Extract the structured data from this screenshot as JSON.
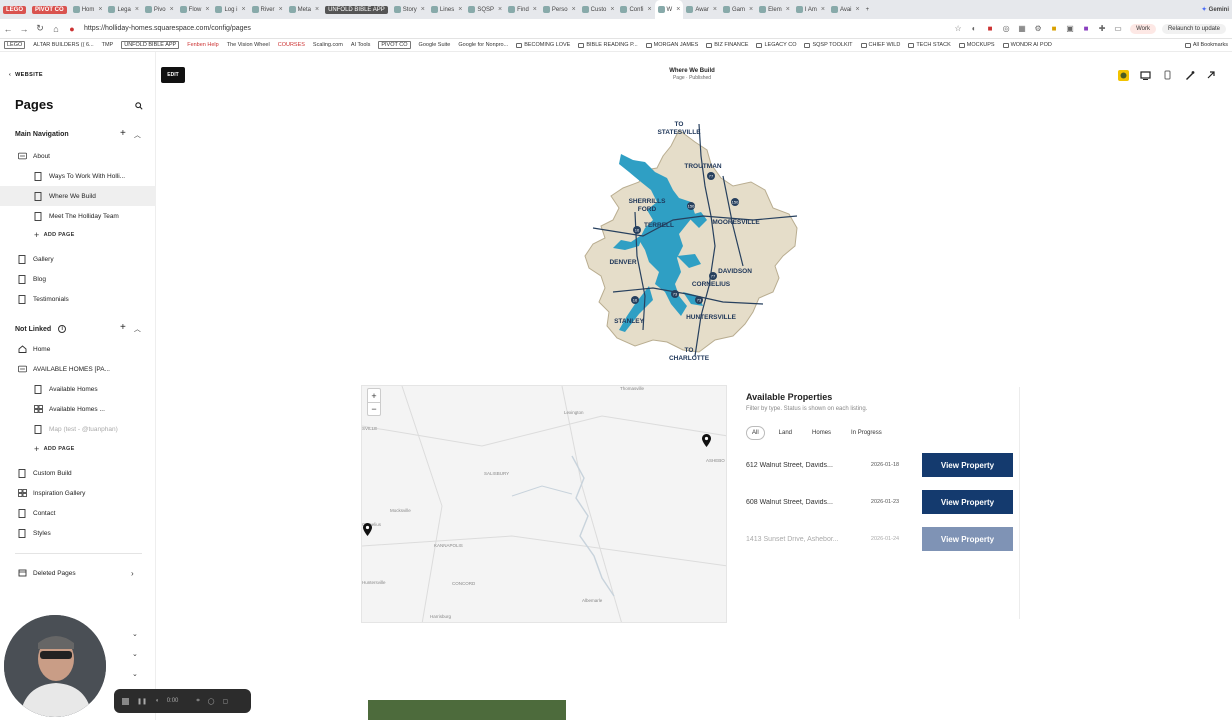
{
  "browser": {
    "tabs": [
      {
        "label": "LEGO",
        "style": "pill"
      },
      {
        "label": "PIVOT CO",
        "style": "pill"
      },
      {
        "label": "Hom",
        "style": "tab"
      },
      {
        "label": "Lega",
        "style": "tab"
      },
      {
        "label": "Pivo",
        "style": "tab"
      },
      {
        "label": "Flow",
        "style": "tab"
      },
      {
        "label": "Log i",
        "style": "tab"
      },
      {
        "label": "River",
        "style": "tab"
      },
      {
        "label": "Meta",
        "style": "tab"
      },
      {
        "label": "UNFOLD BIBLE APP",
        "style": "pill2"
      },
      {
        "label": "Story",
        "style": "tab"
      },
      {
        "label": "Lines",
        "style": "tab"
      },
      {
        "label": "SQSP",
        "style": "tab"
      },
      {
        "label": "Find",
        "style": "tab"
      },
      {
        "label": "Perso",
        "style": "tab"
      },
      {
        "label": "Custo",
        "style": "tab"
      },
      {
        "label": "Confi",
        "style": "tab"
      },
      {
        "label": "W",
        "style": "active"
      },
      {
        "label": "Awar",
        "style": "tab"
      },
      {
        "label": "Gam",
        "style": "tab"
      },
      {
        "label": "Elem",
        "style": "tab"
      },
      {
        "label": "I Am",
        "style": "tab"
      },
      {
        "label": "Avai",
        "style": "tab"
      }
    ],
    "gemini_label": "Gemini",
    "url": "https://holliday-homes.squarespace.com/config/pages",
    "work_label": "Work",
    "relaunch_label": "Relaunch to update",
    "bookmarks": [
      {
        "label": "LEGO",
        "style": "box"
      },
      {
        "label": "ALTAR BUILDERS (( 6...",
        "style": "plain"
      },
      {
        "label": "TMP",
        "style": "plain"
      },
      {
        "label": "UNFOLD BIBLE APP",
        "style": "box"
      },
      {
        "label": "Fenben Help",
        "style": "red"
      },
      {
        "label": "The Vision Wheel",
        "style": "plain"
      },
      {
        "label": "COURSES",
        "style": "red"
      },
      {
        "label": "Scaling.com",
        "style": "plain"
      },
      {
        "label": "AI Tools",
        "style": "plain"
      },
      {
        "label": "PIVOT CO",
        "style": "box"
      },
      {
        "label": "Google Suite",
        "style": "plain"
      },
      {
        "label": "Google for Nonpro...",
        "style": "plain"
      },
      {
        "label": "BECOMING LOVE",
        "style": "folder"
      },
      {
        "label": "BIBLE READING P...",
        "style": "folder"
      },
      {
        "label": "MORGAN JAMES",
        "style": "folder"
      },
      {
        "label": "BIZ FINANCE",
        "style": "folder"
      },
      {
        "label": "LEGACY CO",
        "style": "folder"
      },
      {
        "label": "SQSP TOOLKIT",
        "style": "folder"
      },
      {
        "label": "CHIEF WILD",
        "style": "folder"
      },
      {
        "label": "TECH STACK",
        "style": "folder"
      },
      {
        "label": "MOCKUPS",
        "style": "folder"
      },
      {
        "label": "WONDR AI POD",
        "style": "folder"
      }
    ],
    "all_bookmarks": "All Bookmarks"
  },
  "sidebar": {
    "back_label": "WEBSITE",
    "title": "Pages",
    "main_nav_label": "Main Navigation",
    "not_linked_label": "Not Linked",
    "add_page_label": "ADD PAGE",
    "main_items": [
      {
        "label": "About",
        "level": 0,
        "icon": "folder"
      },
      {
        "label": "Ways To Work With Holli...",
        "level": 1,
        "icon": "page"
      },
      {
        "label": "Where We Build",
        "level": 1,
        "icon": "page",
        "selected": true
      },
      {
        "label": "Meet The Holliday Team",
        "level": 1,
        "icon": "page"
      }
    ],
    "main_items_2": [
      {
        "label": "Gallery",
        "icon": "page"
      },
      {
        "label": "Blog",
        "icon": "page"
      },
      {
        "label": "Testimonials",
        "icon": "page"
      }
    ],
    "not_linked_items": [
      {
        "label": "Home",
        "icon": "home"
      },
      {
        "label": "AVAILABLE HOMES [PA...",
        "icon": "folder"
      },
      {
        "label": "Available Homes",
        "icon": "page",
        "level": 1
      },
      {
        "label": "Available Homes ...",
        "icon": "grid",
        "level": 1
      },
      {
        "label": "Map (test - @tuanphan)",
        "icon": "page",
        "level": 1,
        "dim": true
      }
    ],
    "not_linked_items_2": [
      {
        "label": "Custom Build",
        "icon": "page"
      },
      {
        "label": "Inspiration Gallery",
        "icon": "grid"
      },
      {
        "label": "Contact",
        "icon": "page"
      },
      {
        "label": "Styles",
        "icon": "page"
      }
    ],
    "deleted_label": "Deleted Pages"
  },
  "editor": {
    "edit_label": "EDIT",
    "page_name": "Where We Build",
    "page_status": "Page · Published"
  },
  "region_map": {
    "labels": {
      "to_statesville": [
        "TO",
        "STATESVILLE"
      ],
      "troutman": "TROUTMAN",
      "sherrills_ford": [
        "SHERRILLS",
        "FORD"
      ],
      "terrell": "TERRELL",
      "mooresville": "MOORESVILLE",
      "denver": "DENVER",
      "davidson": "DAVIDSON",
      "cornelius": "CORNELIUS",
      "stanley": "STANLEY",
      "huntersville": "HUNTERSVILLE",
      "to_charlotte": [
        "TO",
        "CHARLOTTE"
      ]
    },
    "shields": [
      "77",
      "150",
      "150",
      "16",
      "77",
      "73",
      "16",
      "73"
    ]
  },
  "map_widget": {
    "zoom_in": "+",
    "zoom_out": "−",
    "places": [
      "Thomasville",
      "Lexington",
      "SVILLE",
      "ASHEBO",
      "SALISBURY",
      "Mocksville",
      "KANNAPOLIS",
      "Cornelius",
      "Huntersville",
      "CONCORD",
      "Albemarle",
      "Troy",
      "Harrisburg"
    ]
  },
  "properties": {
    "title": "Available Properties",
    "subtitle": "Filter by type. Status is shown on each listing.",
    "filters": [
      "All",
      "Land",
      "Homes",
      "In Progress"
    ],
    "active_filter": "All",
    "button_label": "View Property",
    "rows": [
      {
        "address": "612 Walnut Street, Davids...",
        "date": "2026-01-18",
        "dim": false
      },
      {
        "address": "608 Walnut Street, Davids...",
        "date": "2026-01-23",
        "dim": false
      },
      {
        "address": "1413 Sunset Drive, Ashebor...",
        "date": "2026-01-24",
        "dim": true
      }
    ]
  },
  "recorder": {
    "time": "0:00"
  },
  "colors": {
    "accent": "#143a6e",
    "lake": "#2f9fc4",
    "land": "#e5ddc9"
  }
}
